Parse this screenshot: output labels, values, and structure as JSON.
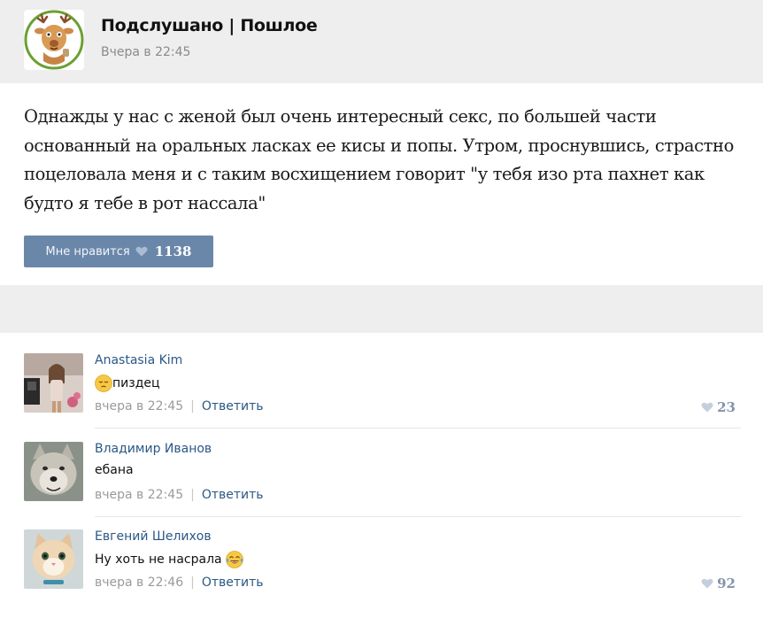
{
  "post": {
    "group_name": "Подслушано | Пошлое",
    "time": "Вчера в 22:45",
    "text_lines": [
      "Однажды у нас с женой был очень интересный секс, по большей части",
      "основанный на оральных ласках ее кисы и попы. Утром, проснувшись, страстно",
      "поцеловала меня и с таким восхищением говорит \"у тебя изо рта пахнет как",
      "будто я тебе в рот нассала\""
    ],
    "like_label": "Мне нравится",
    "like_count": "1138"
  },
  "comments": [
    {
      "author": "Anastasia Kim",
      "text": "пиздец",
      "emoji_before": "pensive-face",
      "time": "вчера в 22:45",
      "reply_label": "Ответить",
      "likes": "23"
    },
    {
      "author": "Владимир Иванов",
      "text": "ебана",
      "time": "вчера в 22:45",
      "reply_label": "Ответить",
      "likes": ""
    },
    {
      "author": "Евгений Шелихов",
      "text": "Ну хоть не насрала",
      "emoji_after": "tears-of-joy-face",
      "time": "вчера в 22:46",
      "reply_label": "Ответить",
      "likes": "92"
    }
  ],
  "colors": {
    "header_bg": "#eeeeee",
    "link": "#2a5885",
    "like_button": "#6a87aa",
    "muted": "#9a9a9a"
  },
  "icons": {
    "like": "heart-icon",
    "group_avatar": "deer-mascot-icon"
  }
}
